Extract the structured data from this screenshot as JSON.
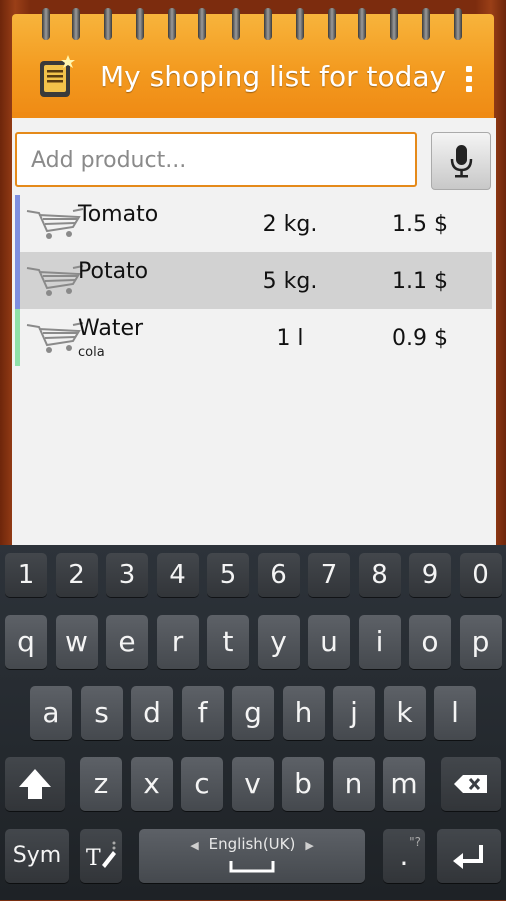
{
  "header": {
    "title": "My shoping list for today"
  },
  "search": {
    "placeholder": "Add product..."
  },
  "items": [
    {
      "name": "Tomato",
      "sub": "",
      "qty": "2 kg.",
      "price": "1.5 $",
      "color": "#7e8fe0",
      "selected": false
    },
    {
      "name": "Potato",
      "sub": "",
      "qty": "5 kg.",
      "price": "1.1 $",
      "color": "#7e8fe0",
      "selected": true
    },
    {
      "name": "Water",
      "sub": "cola",
      "qty": "1 l",
      "price": "0.9 $",
      "color": "#8fe0a8",
      "selected": false
    }
  ],
  "keyboard": {
    "row_numbers": [
      "1",
      "2",
      "3",
      "4",
      "5",
      "6",
      "7",
      "8",
      "9",
      "0"
    ],
    "row1": [
      "q",
      "w",
      "e",
      "r",
      "t",
      "y",
      "u",
      "i",
      "o",
      "p"
    ],
    "row2": [
      "a",
      "s",
      "d",
      "f",
      "g",
      "h",
      "j",
      "k",
      "l"
    ],
    "row3": [
      "z",
      "x",
      "c",
      "v",
      "b",
      "n",
      "m"
    ],
    "sym_label": "Sym",
    "language_label": "English(UK)",
    "period_label": ".",
    "period_hint": "\"?"
  }
}
